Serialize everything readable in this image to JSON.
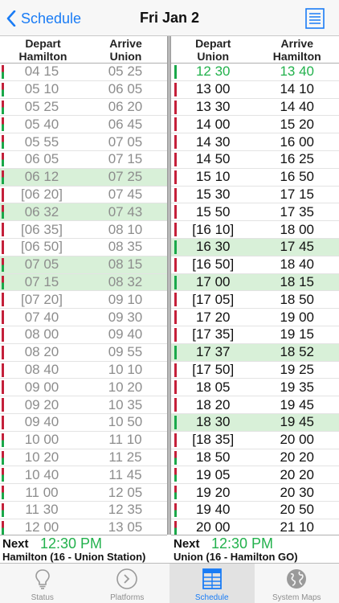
{
  "nav": {
    "back_label": "Schedule",
    "title": "Fri Jan 2"
  },
  "left": {
    "headers": [
      "Depart\nHamilton",
      "Arrive\nUnion"
    ],
    "rows": [
      [
        "04 15",
        "05 25",
        "mix",
        false
      ],
      [
        "05 10",
        "06 05",
        "mix",
        false
      ],
      [
        "05 25",
        "06 20",
        "mix",
        false
      ],
      [
        "05 40",
        "06 45",
        "mix",
        false
      ],
      [
        "05 55",
        "07 05",
        "mix",
        false
      ],
      [
        "06 05",
        "07 15",
        "mix",
        false
      ],
      [
        "06 12",
        "07 25",
        "mix",
        true
      ],
      [
        "[06 20]",
        "07 45",
        "red",
        false
      ],
      [
        "06 32",
        "07 43",
        "mix",
        true
      ],
      [
        "[06 35]",
        "08 10",
        "red",
        false
      ],
      [
        "[06 50]",
        "08 35",
        "red",
        false
      ],
      [
        "07 05",
        "08 15",
        "mix",
        true
      ],
      [
        "07 15",
        "08 32",
        "mix",
        true
      ],
      [
        "[07 20]",
        "09 10",
        "red",
        false
      ],
      [
        "07 40",
        "09 30",
        "red",
        false
      ],
      [
        "08 00",
        "09 40",
        "red",
        false
      ],
      [
        "08 20",
        "09 55",
        "red",
        false
      ],
      [
        "08 40",
        "10 10",
        "red",
        false
      ],
      [
        "09 00",
        "10 20",
        "red",
        false
      ],
      [
        "09 20",
        "10 35",
        "red",
        false
      ],
      [
        "09 40",
        "10 50",
        "red",
        false
      ],
      [
        "10 00",
        "11 10",
        "mix",
        false
      ],
      [
        "10 20",
        "11 25",
        "mix",
        false
      ],
      [
        "10 40",
        "11 45",
        "mix",
        false
      ],
      [
        "11 00",
        "12 05",
        "mix",
        false
      ],
      [
        "11 30",
        "12 35",
        "mix",
        false
      ],
      [
        "12 00",
        "13 05",
        "mix",
        false
      ]
    ],
    "next_label": "Next",
    "next_time": "12:30 PM",
    "next_route": "Hamilton (16 - Union Station)"
  },
  "right": {
    "headers": [
      "Depart\nUnion",
      "Arrive\nHamilton"
    ],
    "rows": [
      [
        "12 30",
        "13 40",
        "green",
        false,
        true
      ],
      [
        "13 00",
        "14 10",
        "red",
        false,
        false
      ],
      [
        "13 30",
        "14 40",
        "red",
        false,
        false
      ],
      [
        "14 00",
        "15 20",
        "red",
        false,
        false
      ],
      [
        "14 30",
        "16 00",
        "red",
        false,
        false
      ],
      [
        "14 50",
        "16 25",
        "red",
        false,
        false
      ],
      [
        "15 10",
        "16 50",
        "red",
        false,
        false
      ],
      [
        "15 30",
        "17 15",
        "red",
        false,
        false
      ],
      [
        "15 50",
        "17 35",
        "red",
        false,
        false
      ],
      [
        "[16 10]",
        "18 00",
        "red",
        false,
        false
      ],
      [
        "16 30",
        "17 45",
        "green",
        true,
        false
      ],
      [
        "[16 50]",
        "18 40",
        "red",
        false,
        false
      ],
      [
        "17 00",
        "18 15",
        "green",
        true,
        false
      ],
      [
        "[17 05]",
        "18 50",
        "red",
        false,
        false
      ],
      [
        "17 20",
        "19 00",
        "red",
        false,
        false
      ],
      [
        "[17 35]",
        "19 15",
        "red",
        false,
        false
      ],
      [
        "17 37",
        "18 52",
        "green",
        true,
        false
      ],
      [
        "[17 50]",
        "19 25",
        "red",
        false,
        false
      ],
      [
        "18 05",
        "19 35",
        "red",
        false,
        false
      ],
      [
        "18 20",
        "19 45",
        "red",
        false,
        false
      ],
      [
        "18 30",
        "19 45",
        "green",
        true,
        false
      ],
      [
        "[18 35]",
        "20 00",
        "red",
        false,
        false
      ],
      [
        "18 50",
        "20 20",
        "mix",
        false,
        false
      ],
      [
        "19 05",
        "20 20",
        "mix",
        false,
        false
      ],
      [
        "19 20",
        "20 30",
        "mix",
        false,
        false
      ],
      [
        "19 40",
        "20 50",
        "mix",
        false,
        false
      ],
      [
        "20 00",
        "21 10",
        "mix",
        false,
        false
      ]
    ],
    "next_label": "Next",
    "next_time": "12:30 PM",
    "next_route": "Union (16 - Hamilton GO)"
  },
  "tabs": [
    {
      "label": "Status",
      "icon": "lightbulb-icon",
      "active": false
    },
    {
      "label": "Platforms",
      "icon": "platform-arrow-icon",
      "active": false
    },
    {
      "label": "Schedule",
      "icon": "schedule-grid-icon",
      "active": true
    },
    {
      "label": "System Maps",
      "icon": "globe-icon",
      "active": false
    }
  ],
  "colors": {
    "accent": "#1a7cf5",
    "next_green": "#22b14c",
    "highlight": "#d8f0d8",
    "bar_red": "#c4203a",
    "bar_green": "#1aa84a"
  }
}
